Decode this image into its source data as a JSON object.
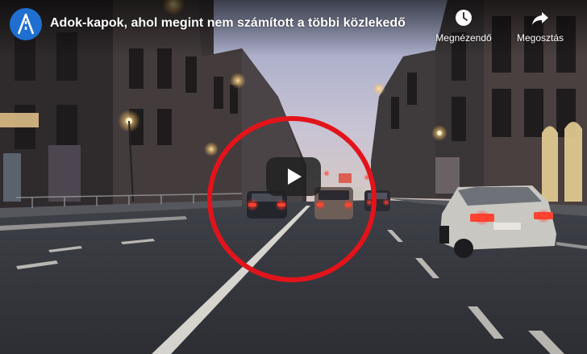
{
  "video": {
    "title": "Adok-kapok, ahol megint nem számított a többi közlekedő",
    "channel_logo": "channel-logo-icon",
    "actions": {
      "watch_later": {
        "label": "Megnézendő",
        "icon": "clock-icon"
      },
      "share": {
        "label": "Megosztás",
        "icon": "share-arrow-icon"
      }
    },
    "play_button": {
      "icon": "play-icon",
      "color": "#212121"
    },
    "highlight_color": "#e3131b"
  }
}
